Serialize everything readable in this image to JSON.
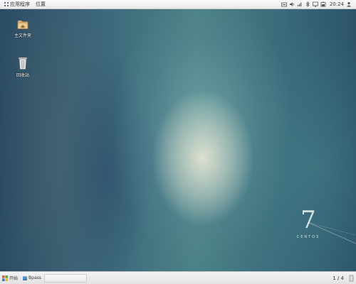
{
  "top_panel": {
    "menus": [
      {
        "id": "applications",
        "label": "应用程序"
      },
      {
        "id": "places",
        "label": "位置"
      }
    ],
    "tray": {
      "clock": "20:24"
    }
  },
  "desktop": {
    "icons": [
      {
        "label": "主文件夹",
        "icon": "home-folder-icon"
      },
      {
        "label": "回收站",
        "icon": "trash-icon"
      }
    ],
    "wallpaper_brand": {
      "number": "7",
      "word": "CENTOS"
    }
  },
  "taskbar": {
    "start_label": "开始",
    "tasks": [
      {
        "label": "Bpass"
      }
    ],
    "workspace": "1 / 4"
  },
  "colors": {
    "panel": "#efefef",
    "desktop_base": "#2d5166",
    "desktop_glow": "#e2e4d2",
    "text": "#333333"
  }
}
